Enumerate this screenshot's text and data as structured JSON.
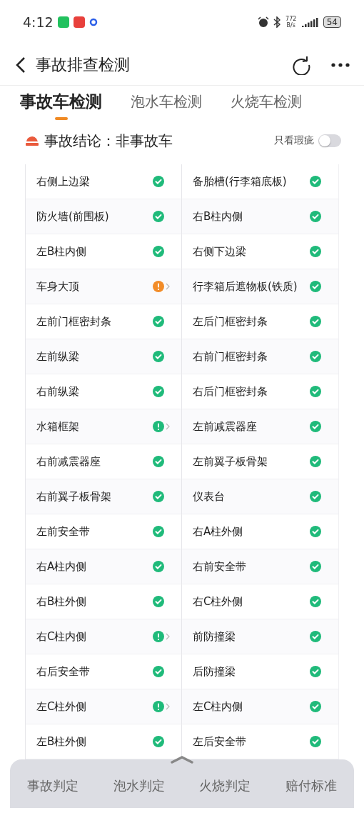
{
  "status_bar": {
    "time": "4:12",
    "speed_value": "772",
    "speed_unit": "B/s",
    "battery": "54"
  },
  "header": {
    "title": "事故排查检测"
  },
  "tabs": [
    {
      "label": "事故车检测",
      "selected": true
    },
    {
      "label": "泡水车检测",
      "selected": false
    },
    {
      "label": "火烧车检测",
      "selected": false
    }
  ],
  "conclusion": {
    "label": "事故结论：",
    "value": "非事故车",
    "filter": {
      "label": "只看瑕疵",
      "on": false
    }
  },
  "items": [
    {
      "name": "右侧上边梁",
      "kind": "ok"
    },
    {
      "name": "备胎槽(行李箱底板)",
      "kind": "ok"
    },
    {
      "name": "防火墙(前围板)",
      "kind": "ok"
    },
    {
      "name": "右B柱内侧",
      "kind": "ok"
    },
    {
      "name": "左B柱内侧",
      "kind": "ok"
    },
    {
      "name": "右侧下边梁",
      "kind": "ok"
    },
    {
      "name": "车身大顶",
      "kind": "warning"
    },
    {
      "name": "行李箱后遮物板(铁质)",
      "kind": "ok"
    },
    {
      "name": "左前门框密封条",
      "kind": "ok"
    },
    {
      "name": "左后门框密封条",
      "kind": "ok"
    },
    {
      "name": "左前纵梁",
      "kind": "ok"
    },
    {
      "name": "右前门框密封条",
      "kind": "ok"
    },
    {
      "name": "右前纵梁",
      "kind": "ok"
    },
    {
      "name": "右后门框密封条",
      "kind": "ok"
    },
    {
      "name": "水箱框架",
      "kind": "notice"
    },
    {
      "name": "左前减震器座",
      "kind": "ok"
    },
    {
      "name": "右前减震器座",
      "kind": "ok"
    },
    {
      "name": "左前翼子板骨架",
      "kind": "ok"
    },
    {
      "name": "右前翼子板骨架",
      "kind": "ok"
    },
    {
      "name": "仪表台",
      "kind": "ok"
    },
    {
      "name": "左前安全带",
      "kind": "ok"
    },
    {
      "name": "右A柱外侧",
      "kind": "ok"
    },
    {
      "name": "右A柱内侧",
      "kind": "ok"
    },
    {
      "name": "右前安全带",
      "kind": "ok"
    },
    {
      "name": "右B柱外侧",
      "kind": "ok"
    },
    {
      "name": "右C柱外侧",
      "kind": "ok"
    },
    {
      "name": "右C柱内侧",
      "kind": "notice"
    },
    {
      "name": "前防撞梁",
      "kind": "ok"
    },
    {
      "name": "右后安全带",
      "kind": "ok"
    },
    {
      "name": "后防撞梁",
      "kind": "ok"
    },
    {
      "name": "左C柱外侧",
      "kind": "notice"
    },
    {
      "name": "左C柱内侧",
      "kind": "ok"
    },
    {
      "name": "左B柱外侧",
      "kind": "ok"
    },
    {
      "name": "左后安全带",
      "kind": "ok"
    }
  ],
  "bottom_nav": [
    "事故判定",
    "泡水判定",
    "火烧判定",
    "赔付标准"
  ]
}
